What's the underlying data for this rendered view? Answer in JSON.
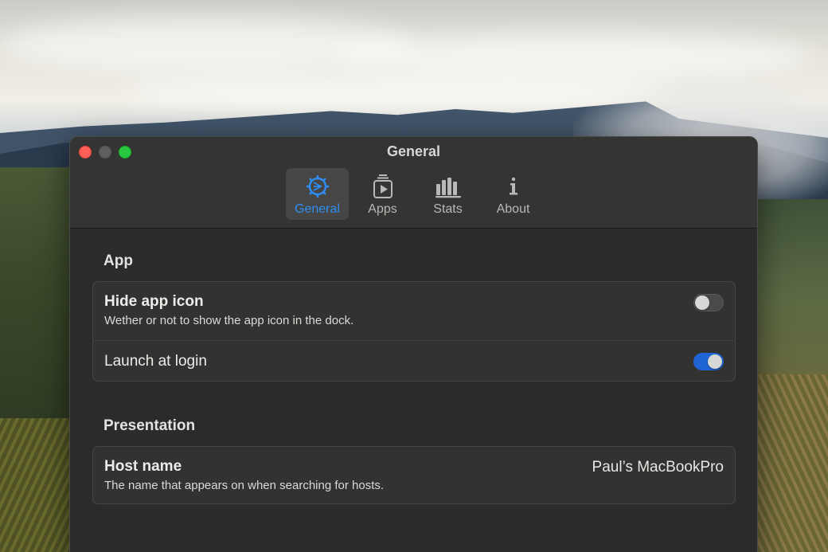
{
  "window": {
    "title": "General",
    "traffic_lights": {
      "close": "#ff5f57",
      "minimize": "#5e5e5c",
      "maximize": "#28c840"
    }
  },
  "tabs": [
    {
      "label": "General",
      "icon": "gear-icon",
      "active": true
    },
    {
      "label": "Apps",
      "icon": "play-stack-icon",
      "active": false
    },
    {
      "label": "Stats",
      "icon": "bar-chart-icon",
      "active": false
    },
    {
      "label": "About",
      "icon": "info-icon",
      "active": false
    }
  ],
  "sections": {
    "app": {
      "title": "App",
      "hide_icon": {
        "title": "Hide app icon",
        "subtitle": "Wether or not to show the app icon in the dock.",
        "enabled": false
      },
      "launch_login": {
        "title": "Launch at login",
        "enabled": true
      }
    },
    "presentation": {
      "title": "Presentation",
      "host_name": {
        "title": "Host name",
        "subtitle": "The name that appears on when searching for hosts.",
        "value": "Paul’s MacBookPro"
      }
    }
  },
  "colors": {
    "accent": "#2f8ef5",
    "toggle_on": "#2065d6",
    "window_bg": "#2b2b29"
  }
}
